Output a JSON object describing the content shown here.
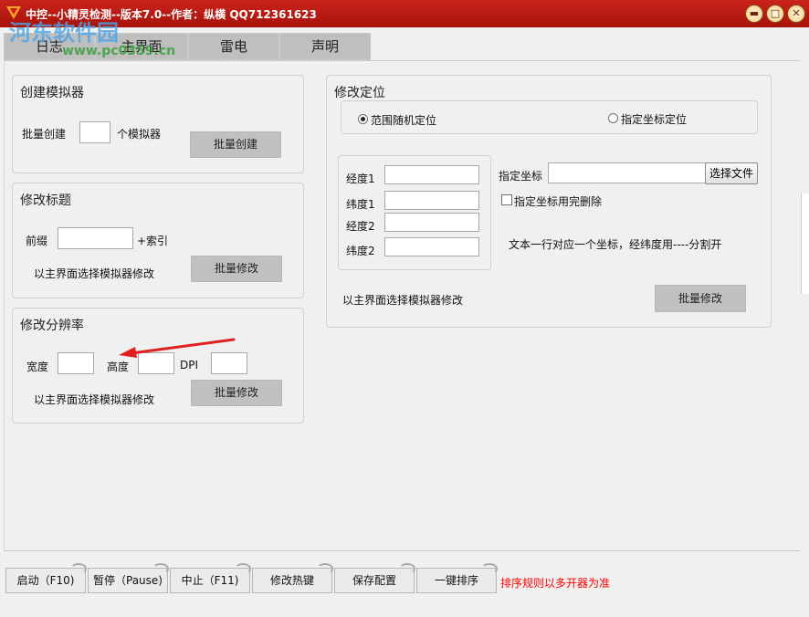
{
  "window": {
    "title": "中控--小精灵检测--版本7.0--作者：纵横 QQ712361623",
    "minimize": "▬",
    "maximize": "□",
    "close": "✕"
  },
  "watermark": {
    "text": "河东软件园",
    "url": "www.pc0359.cn"
  },
  "tabs": [
    "日志",
    "主界面",
    "雷电",
    "声明"
  ],
  "create_emulator": {
    "title": "创建模拟器",
    "batch_label": "批量创建",
    "count_value": "",
    "unit_label": "个模拟器",
    "button": "批量创建"
  },
  "modify_title": {
    "title": "修改标题",
    "prefix_label": "前缀",
    "prefix_value": "",
    "index_label": "+索引",
    "hint": "以主界面选择模拟器修改",
    "button": "批量修改"
  },
  "modify_resolution": {
    "title": "修改分辨率",
    "width_label": "宽度",
    "height_label": "高度",
    "dpi_label": "DPI",
    "hint": "以主界面选择模拟器修改",
    "button": "批量修改"
  },
  "modify_location": {
    "title": "修改定位",
    "radio_random": "范围随机定位",
    "radio_fixed": "指定坐标定位",
    "lng1": "经度1",
    "lat1": "纬度1",
    "lng2": "经度2",
    "lat2": "纬度2",
    "fixed_label": "指定坐标",
    "fixed_value": "",
    "choose_file": "选择文件",
    "delete_after": "指定坐标用完删除",
    "file_hint": "文本一行对应一个坐标，经纬度用----分割开",
    "hint": "以主界面选择模拟器修改",
    "button": "批量修改"
  },
  "bottom": {
    "buttons": [
      "启动（F10)",
      "暂停（Pause)",
      "中止（F11)",
      "修改热键",
      "保存配置",
      "一键排序"
    ],
    "sort_hint": "排序规则以多开器为准"
  },
  "colors": {
    "titlebar": "#b81a12",
    "hint_red": "#ff0000",
    "arrow": "#e02020"
  }
}
